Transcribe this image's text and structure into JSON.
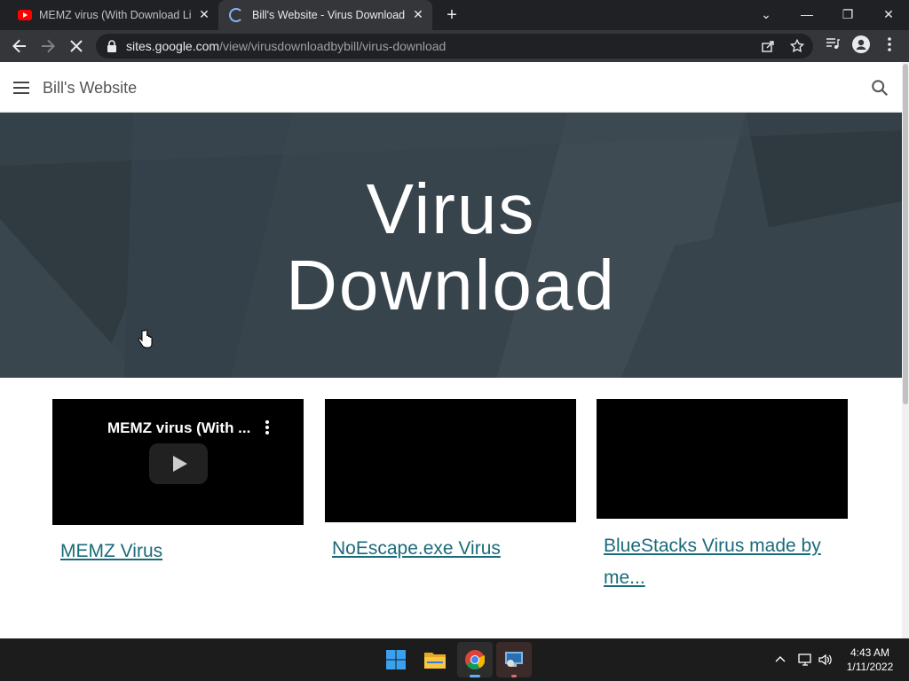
{
  "browser": {
    "tabs": [
      {
        "title": "MEMZ virus (With Download Lin",
        "icon": "youtube-icon",
        "active": false
      },
      {
        "title": "Bill's Website - Virus Download",
        "icon": "loading-spinner-icon",
        "active": true
      }
    ],
    "url": {
      "host": "sites.google.com",
      "path": "/view/virusdownloadbybill/virus-download"
    }
  },
  "site": {
    "title": "Bill's Website",
    "banner": {
      "line1": "Virus",
      "line2": "Download",
      "color": "#38444c"
    },
    "videos": [
      {
        "embed_title": "MEMZ virus (With ...",
        "link": "MEMZ Virus"
      },
      {
        "embed_title": "",
        "link": "NoEscape.exe Virus"
      },
      {
        "embed_title": "",
        "link": "BlueStacks Virus made by me..."
      }
    ],
    "link_color": "#1a6b7a"
  },
  "taskbar": {
    "apps": [
      "windows-start-icon",
      "file-explorer-icon",
      "chrome-icon",
      "remote-desktop-icon"
    ],
    "time": "4:43 AM",
    "date": "1/11/2022"
  }
}
